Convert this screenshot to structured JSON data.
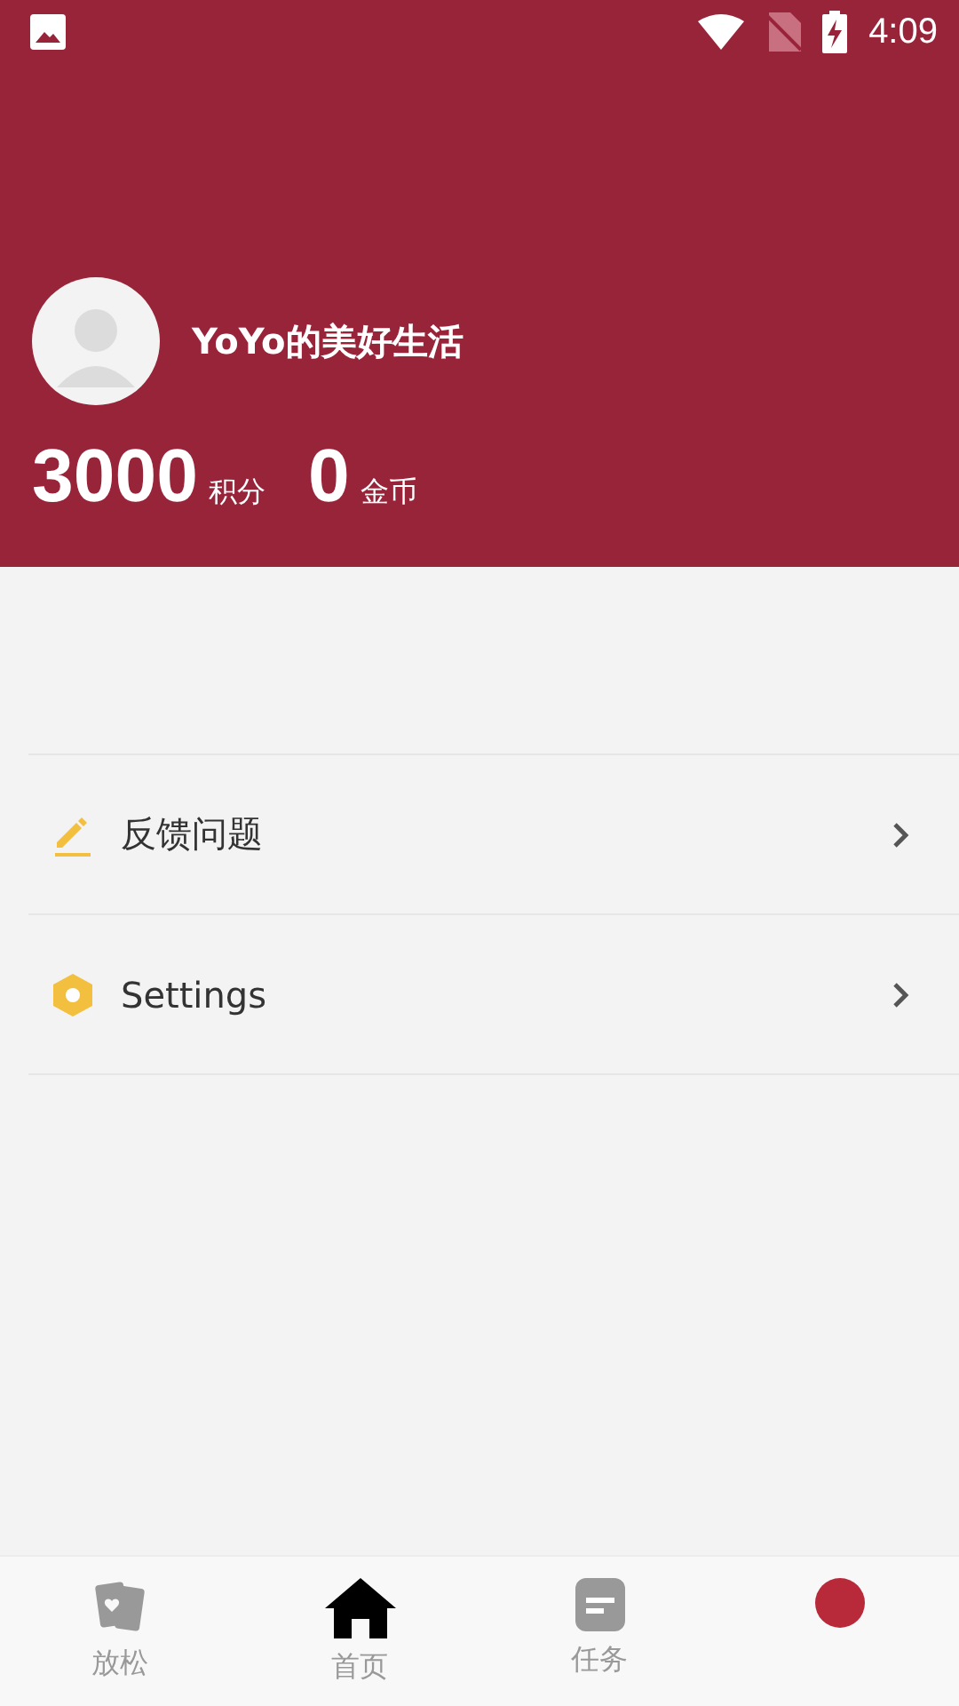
{
  "status_bar": {
    "time": "4:09"
  },
  "profile": {
    "name": "YoYo的美好生活",
    "stats": [
      {
        "value": "3000",
        "unit": "积分"
      },
      {
        "value": "0",
        "unit": "金币"
      }
    ]
  },
  "menu": [
    {
      "kind": "pencil",
      "label": "反馈问题"
    },
    {
      "kind": "hexagon",
      "label": "Settings"
    }
  ],
  "tabs": [
    {
      "kind": "cards",
      "label": "放松"
    },
    {
      "kind": "home",
      "label": "首页"
    },
    {
      "kind": "task",
      "label": "任务"
    },
    {
      "kind": "dot"
    }
  ]
}
